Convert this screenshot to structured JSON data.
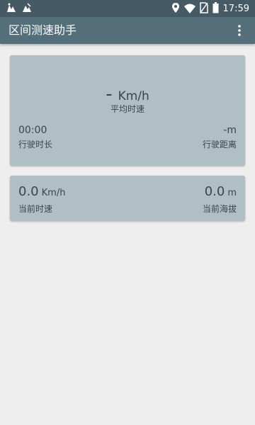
{
  "status_bar": {
    "time": "17:59",
    "left_icons": [
      "notification-icon",
      "notification-icon"
    ],
    "right_icons": [
      "location-icon",
      "wifi-icon",
      "no-sim-icon",
      "battery-icon"
    ]
  },
  "app_bar": {
    "title": "区间测速助手",
    "menu_icon": "more-vert-icon"
  },
  "trip_card": {
    "avg_speed_value": "-",
    "avg_speed_unit": "Km/h",
    "avg_speed_label": "平均时速",
    "duration_value": "00:00",
    "duration_label": "行驶时长",
    "distance_value": "-m",
    "distance_label": "行驶距离"
  },
  "current_card": {
    "speed_value": "0.0",
    "speed_unit": "Km/h",
    "speed_label": "当前时速",
    "altitude_value": "0.0",
    "altitude_unit": "m",
    "altitude_label": "当前海拔"
  },
  "colors": {
    "status_bar": "#455a64",
    "app_bar": "#546e7a",
    "card": "#b0bec5",
    "background": "#eeeeee",
    "text": "#37474f"
  }
}
